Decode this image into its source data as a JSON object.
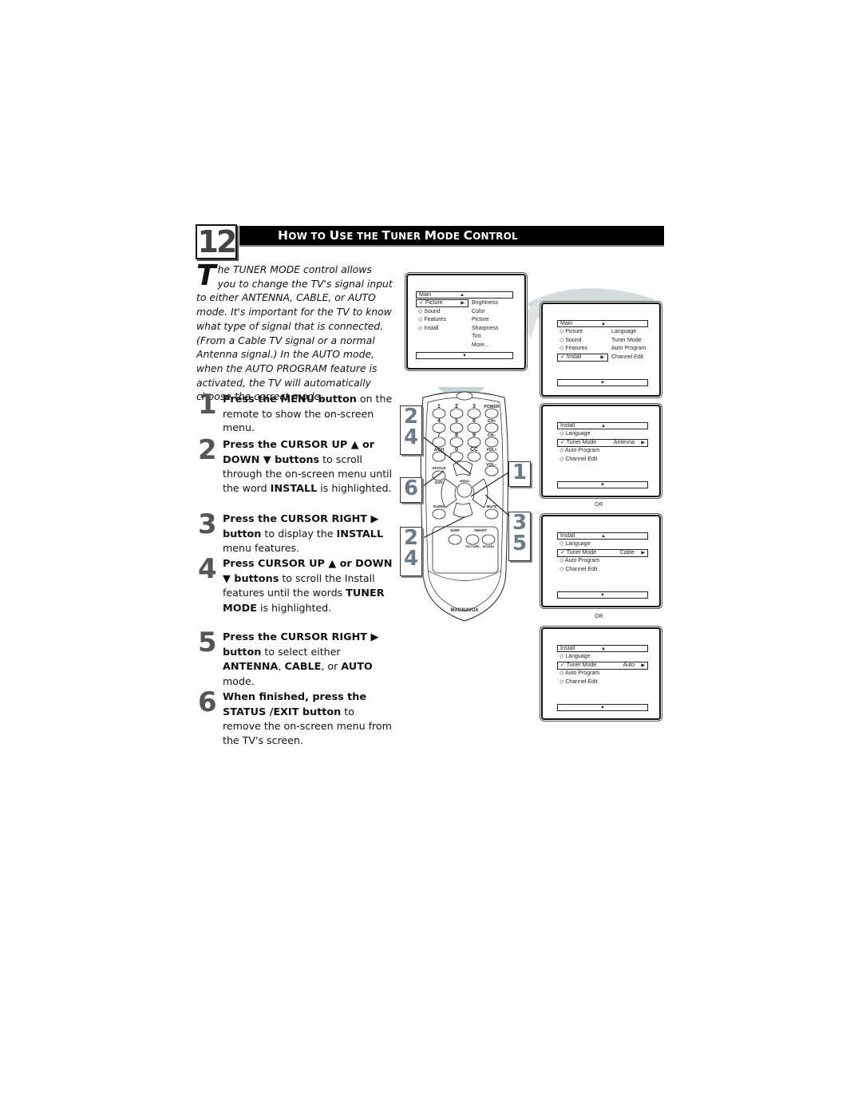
{
  "header": {
    "page_number": "12",
    "title_parts": [
      {
        "text": "H",
        "cap": true
      },
      {
        "text": "OW TO ",
        "cap": false
      },
      {
        "text": "U",
        "cap": true
      },
      {
        "text": "SE THE ",
        "cap": false
      },
      {
        "text": "T",
        "cap": true
      },
      {
        "text": "UNER ",
        "cap": false
      },
      {
        "text": "M",
        "cap": true
      },
      {
        "text": "ODE ",
        "cap": false
      },
      {
        "text": "C",
        "cap": true
      },
      {
        "text": "ONTROL",
        "cap": false
      }
    ],
    "title": "How to Use the Tuner Mode Control"
  },
  "intro": {
    "dropcap": "T",
    "text": "he TUNER MODE control allows you to change the TV's signal input to either ANTENNA, CABLE, or AUTO mode. It's important for the TV to know what type of signal that is connected. (From a Cable TV signal or a normal Antenna signal.) In the AUTO mode, when the AUTO PROGRAM feature is activated, the TV will automatically choose the correct mode."
  },
  "steps": [
    {
      "num": "1",
      "bold": "Press the MENU button",
      "rest": " on the remote to show the on-screen menu."
    },
    {
      "num": "2",
      "bold": "Press the CURSOR UP ▲ or DOWN ▼ buttons",
      "rest": " to scroll through the on-screen menu until the word ",
      "bold2": "INSTALL",
      "rest2": " is highlighted."
    },
    {
      "num": "3",
      "bold": "Press the CURSOR RIGHT ▶ button",
      "rest": " to display the ",
      "bold2": "INSTALL",
      "rest2": " menu features."
    },
    {
      "num": "4",
      "bold": "Press CURSOR UP ▲ or DOWN ▼ buttons",
      "rest": " to scroll the Install features until the words ",
      "bold2": "TUNER MODE",
      "rest2": " is highlighted."
    },
    {
      "num": "5",
      "bold": "Press the CURSOR RIGHT ▶ button",
      "rest": " to select either ",
      "bold2": "ANTENNA",
      "rest2": ", ",
      "bold3": "CABLE",
      "rest3": ", or ",
      "bold4": "AUTO",
      "rest4": " mode."
    },
    {
      "num": "6",
      "bold": "When finished, press the STATUS /EXIT button",
      "rest": " to remove the on-screen menu from the TV's screen."
    }
  ],
  "screens": {
    "main_picture": {
      "header": "Main",
      "left": [
        "Picture",
        "Sound",
        "Features",
        "Install"
      ],
      "selected_left": "Picture",
      "right": [
        "Brightness",
        "Color",
        "Picture",
        "Sharpness",
        "Tint",
        "More..."
      ]
    },
    "main_install": {
      "header": "Main",
      "left": [
        "Picture",
        "Sound",
        "Features",
        "Install"
      ],
      "selected_left": "Install",
      "right": [
        "Language",
        "Tuner Mode",
        "Auto Program",
        "Channel Edit"
      ]
    },
    "install_antenna": {
      "header": "Install",
      "items": [
        "Language",
        "Tuner Mode",
        "Auto Program",
        "Channel Edit"
      ],
      "selected": "Tuner Mode",
      "value": "Antenna"
    },
    "install_cable": {
      "header": "Install",
      "items": [
        "Language",
        "Tuner Mode",
        "Auto Program",
        "Channel Edit"
      ],
      "selected": "Tuner Mode",
      "value": "Cable"
    },
    "install_auto": {
      "header": "Install",
      "items": [
        "Language",
        "Tuner Mode",
        "Auto Program",
        "Channel Edit"
      ],
      "selected": "Tuner Mode",
      "value": "Auto"
    },
    "or_label": "OR"
  },
  "remote": {
    "brand": "MAGNAVOX",
    "keys": [
      "1",
      "2",
      "3",
      "POWER",
      "4",
      "5",
      "6",
      "CH+",
      "7",
      "8",
      "9",
      "CH−",
      "A/CH",
      "0",
      "CC",
      "VOL+",
      "VOL−"
    ],
    "labels": {
      "status": "STATUS",
      "exit": "EXIT",
      "menu": "MENU",
      "sleep": "SLEEP",
      "mute": "MUTE",
      "surf": "SURF",
      "smart": "SMART",
      "picture": "PICTURE",
      "sound": "SOUND"
    },
    "callouts": {
      "left_top": [
        "2",
        "4"
      ],
      "left_mid": [
        "6"
      ],
      "left_bottom": [
        "2",
        "4"
      ],
      "right_top": [
        "1"
      ],
      "right_bottom": [
        "3",
        "5"
      ]
    }
  },
  "colors": {
    "callout_text": "#6b7a86",
    "beam": "#c8d3d6",
    "title_bar": "#000000"
  }
}
